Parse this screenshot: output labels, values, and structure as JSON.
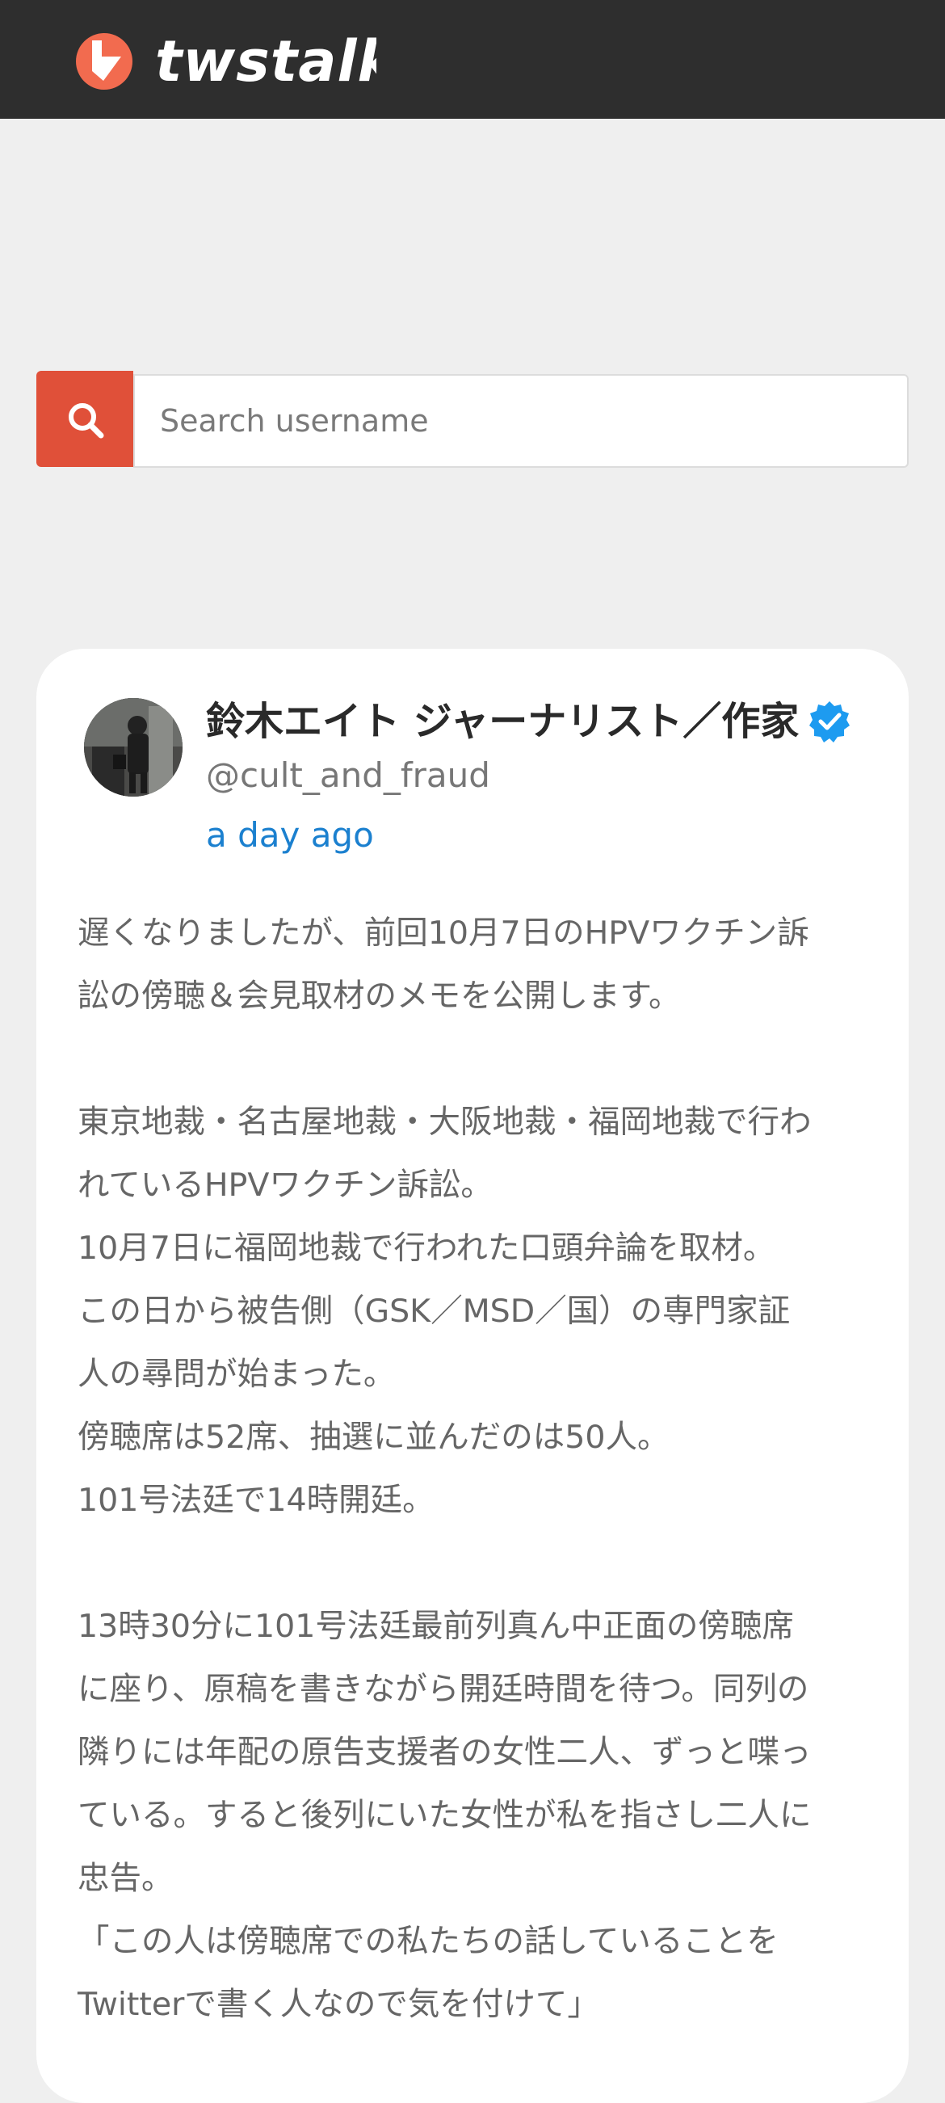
{
  "header": {
    "logo_text": "twstalker",
    "logo_color": "#f26b4f"
  },
  "search": {
    "placeholder": "Search username",
    "button_color": "#e05039",
    "icon": "search-icon"
  },
  "tweet": {
    "display_name": "鈴木エイト ジャーナリスト／作家",
    "verified_icon": "verified-badge-icon",
    "handle": "@cult_and_fraud",
    "time": "a day ago",
    "lines": [
      "遅くなりましたが、前回10月7日のHPVワクチン訴",
      "訟の傍聴＆会見取材のメモを公開します。",
      "",
      "東京地裁・名古屋地裁・大阪地裁・福岡地裁で行わ",
      "れているHPVワクチン訴訟。",
      "10月7日に福岡地裁で行われた口頭弁論を取材。",
      "この日から被告側（GSK／MSD／国）の専門家証",
      "人の尋問が始まった。",
      "傍聴席は52席、抽選に並んだのは50人。",
      "101号法廷で14時開廷。",
      "",
      "13時30分に101号法廷最前列真ん中正面の傍聴席",
      "に座り、原稿を書きながら開廷時間を待つ。同列の",
      "隣りには年配の原告支援者の女性二人、ずっと喋っ",
      "ている。すると後列にいた女性が私を指さし二人に",
      "忠告。",
      "「この人は傍聴席での私たちの話していることを",
      "Twitterで書く人なので気を付けて」"
    ]
  }
}
